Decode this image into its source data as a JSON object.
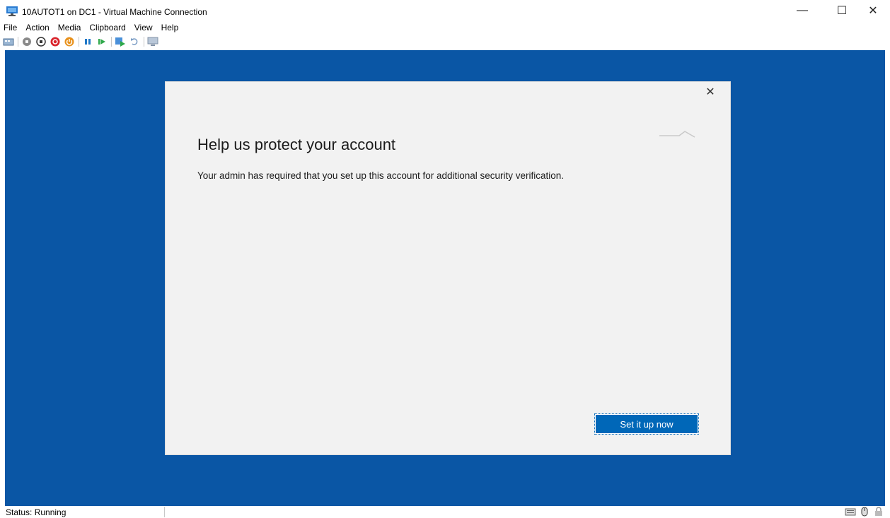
{
  "window": {
    "title": "10AUTOT1 on DC1 - Virtual Machine Connection",
    "minimize_glyph": "—",
    "maximize_glyph": "☐",
    "close_glyph": "✕"
  },
  "menu": [
    "File",
    "Action",
    "Media",
    "Clipboard",
    "View",
    "Help"
  ],
  "toolbar_icons": [
    "ctrl-alt-del-icon",
    "start-icon",
    "turn-off-icon",
    "shut-down-icon",
    "save-icon",
    "pause-icon",
    "resume-icon",
    "checkpoint-icon",
    "revert-icon",
    "enhanced-session-icon"
  ],
  "dialog": {
    "close_glyph": "✕",
    "heading": "Help us protect your account",
    "message": "Your admin has required that you set up this account for additional security verification.",
    "primary_button": "Set it up now"
  },
  "status": {
    "text": "Status: Running"
  },
  "colors": {
    "vm_background": "#0a56a5",
    "dialog_background": "#f2f2f2",
    "primary_button": "#0067b8"
  }
}
